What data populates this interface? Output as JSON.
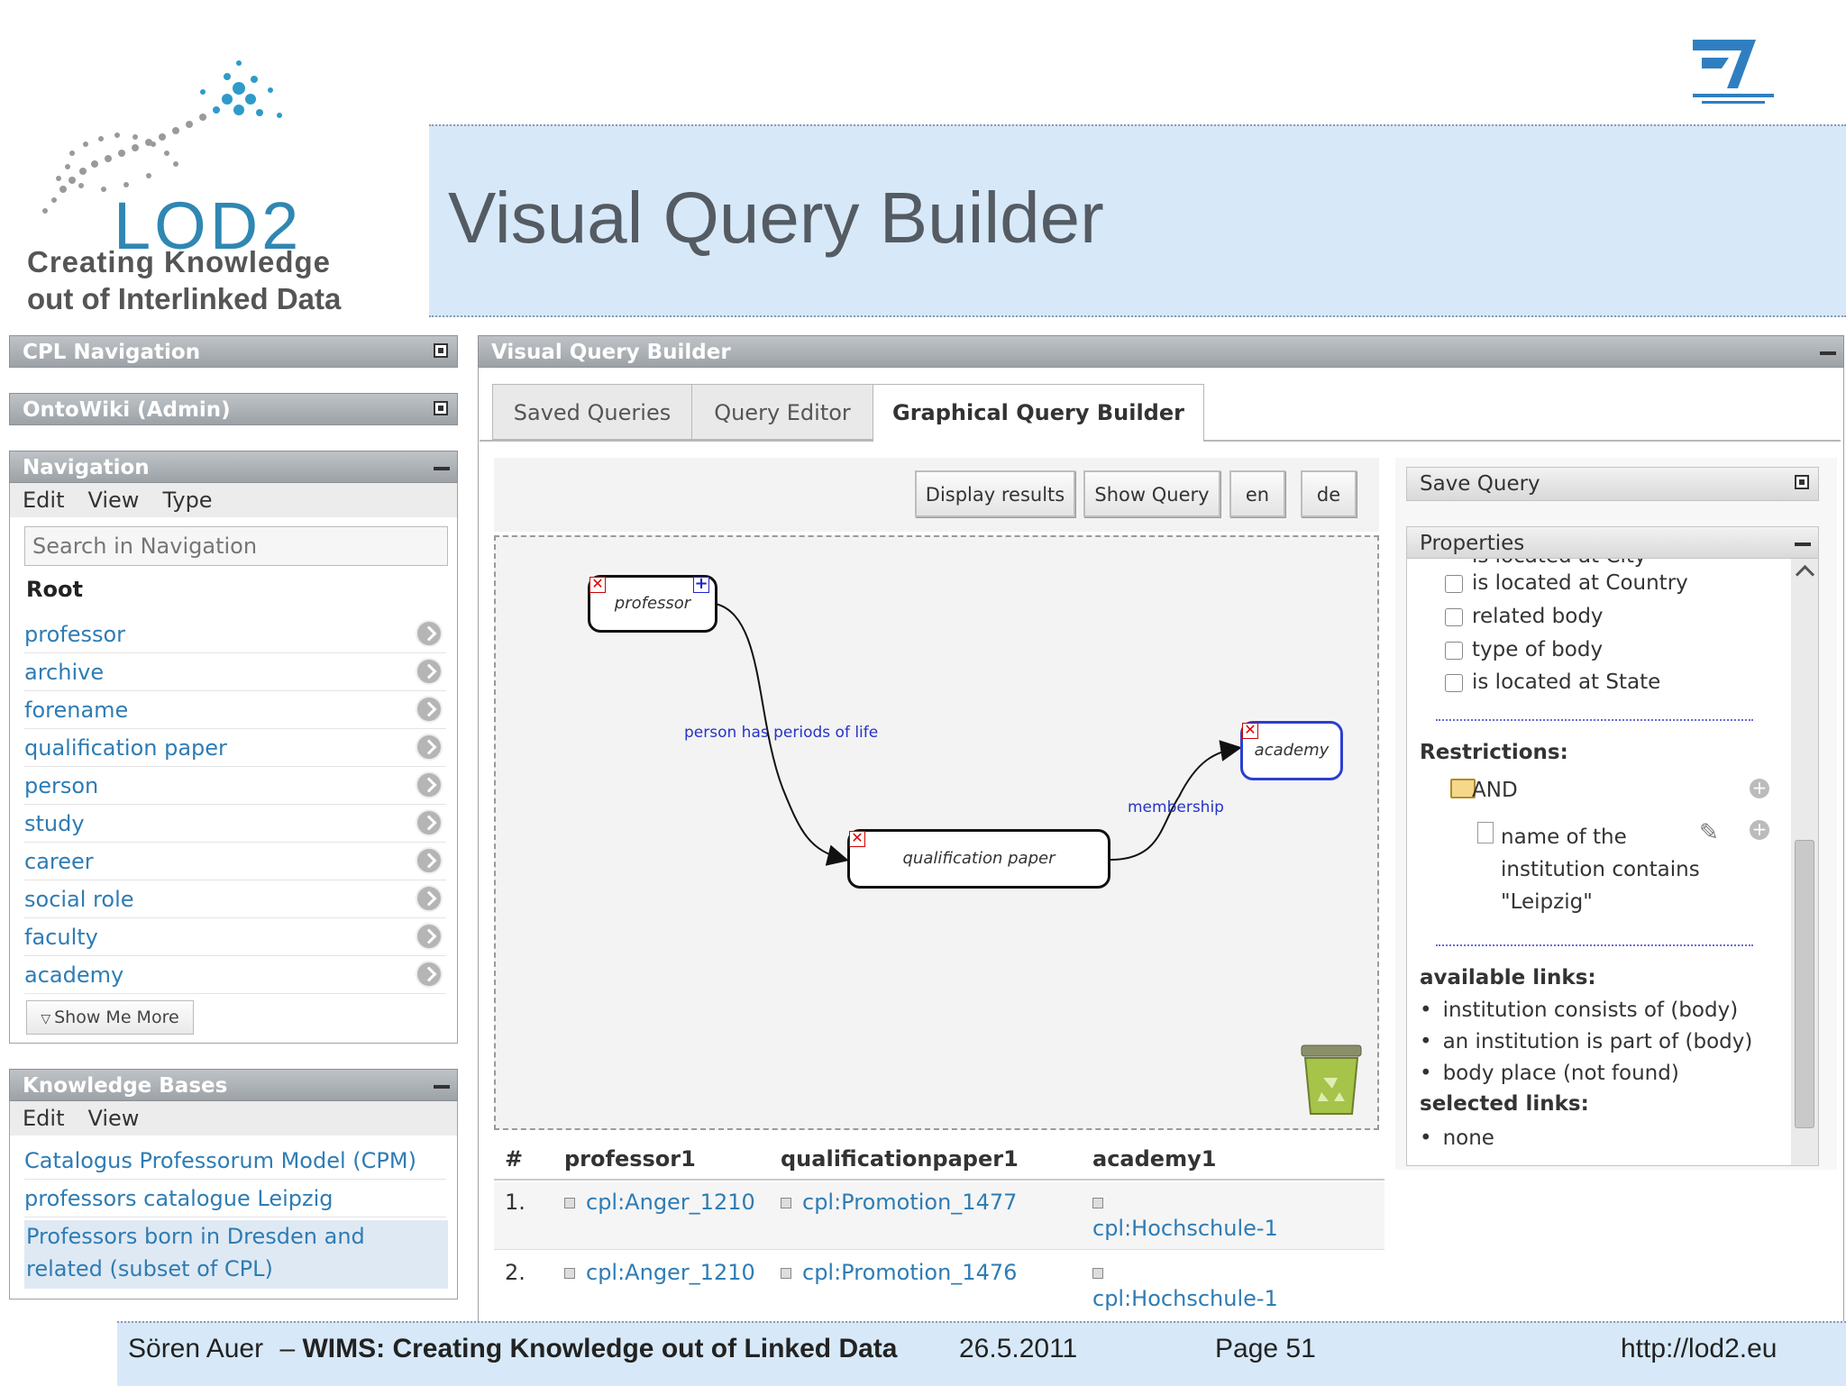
{
  "slide": {
    "title": "Visual Query Builder",
    "logo_text": "LOD2",
    "logo_subtitle_1": "Creating Knowledge",
    "logo_subtitle_2": "out of Interlinked Data"
  },
  "sidebar": {
    "cpl_nav_title": "CPL Navigation",
    "ontowiki_title": "OntoWiki (Admin)",
    "navigation": {
      "title": "Navigation",
      "menu": [
        "Edit",
        "View",
        "Type"
      ],
      "search_placeholder": "Search in Navigation",
      "root_label": "Root",
      "items": [
        "professor",
        "archive",
        "forename",
        "qualification paper",
        "person",
        "study",
        "career",
        "social role",
        "faculty",
        "academy"
      ],
      "show_more": "Show Me More"
    },
    "knowledge_bases": {
      "title": "Knowledge Bases",
      "menu": [
        "Edit",
        "View"
      ],
      "items": [
        "Catalogus Professorum Model (CPM)",
        "professors catalogue Leipzig",
        "Professors born in Dresden and",
        "related (subset of CPL)"
      ]
    }
  },
  "main": {
    "panel_title": "Visual Query Builder",
    "tabs": [
      "Saved Queries",
      "Query Editor",
      "Graphical Query Builder"
    ],
    "active_tab": "Graphical Query Builder",
    "buttons": [
      "Display results",
      "Show Query",
      "en",
      "de"
    ],
    "graph": {
      "nodes": [
        "professor",
        "academy",
        "qualification paper"
      ],
      "edges": [
        "person has periods of life",
        "membership"
      ]
    },
    "results": {
      "headers": [
        "#",
        "professor1",
        "qualificationpaper1",
        "academy1"
      ],
      "rows": [
        [
          "1.",
          "cpl:Anger_1210",
          "cpl:Promotion_1477",
          "cpl:Hochschule-1"
        ],
        [
          "2.",
          "cpl:Anger_1210",
          "cpl:Promotion_1476",
          "cpl:Hochschule-1"
        ]
      ]
    }
  },
  "right_panel": {
    "save_query_title": "Save Query",
    "properties_title": "Properties",
    "clipped_property": "is located at City",
    "properties": [
      "is located at Country",
      "related body",
      "type of body",
      "is located at State"
    ],
    "restrictions_label": "Restrictions:",
    "and_label": "AND",
    "restriction_lines": [
      "name of the",
      "institution contains",
      "\"Leipzig\""
    ],
    "available_links_label": "available links:",
    "available_links": [
      "institution consists of (body)",
      "an institution is part of (body)",
      "body place (not found)"
    ],
    "selected_links_label": "selected links:",
    "selected_links": [
      "none"
    ]
  },
  "footer": {
    "author": "Sören Auer",
    "dash": "–",
    "talk_title": "WIMS: Creating Knowledge out of Linked Data",
    "date": "26.5.2011",
    "page": "Page 51",
    "url": "http://lod2.eu"
  }
}
